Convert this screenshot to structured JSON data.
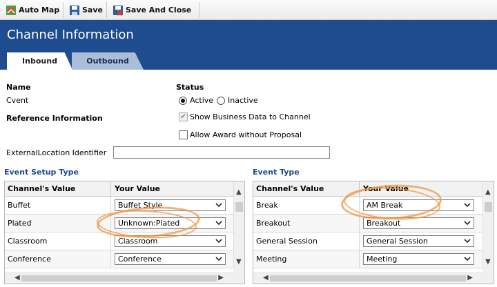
{
  "toolbar": {
    "auto_map": "Auto Map",
    "save": "Save",
    "save_and_close": "Save And Close"
  },
  "header": {
    "title": "Channel Information",
    "tabs": [
      {
        "label": "Inbound",
        "active": true
      },
      {
        "label": "Outbound",
        "active": false
      }
    ]
  },
  "form": {
    "name_label": "Name",
    "name_value": "Cvent",
    "status_label": "Status",
    "status_active": "Active",
    "status_inactive": "Inactive",
    "status_selected": "Active",
    "reference_label": "Reference Information",
    "show_business_data": "Show Business Data to Channel",
    "show_business_data_checked": true,
    "allow_award": "Allow Award without Proposal",
    "allow_award_checked": false,
    "external_location_label": "ExternalLocation Identifier",
    "external_location_value": ""
  },
  "event_setup_type": {
    "title": "Event Setup Type",
    "col_channel": "Channel's Value",
    "col_yours": "Your Value",
    "rows": [
      {
        "channel": "Buffet",
        "yours": "Buffet Style"
      },
      {
        "channel": "Plated",
        "yours": "Unknown:Plated"
      },
      {
        "channel": "Classroom",
        "yours": "Classroom"
      },
      {
        "channel": "Conference",
        "yours": "Conference"
      }
    ]
  },
  "event_type": {
    "title": "Event Type",
    "col_channel": "Channel's Value",
    "col_yours": "Your Value",
    "rows": [
      {
        "channel": "Break",
        "yours": "AM Break"
      },
      {
        "channel": "Breakout",
        "yours": "Breakout"
      },
      {
        "channel": "General Session",
        "yours": "General Session"
      },
      {
        "channel": "Meeting",
        "yours": "Meeting"
      }
    ]
  },
  "colors": {
    "header_bg": "#1f4b8f",
    "section_title": "#1f4b8f",
    "annotation_ring": "#f0a050"
  }
}
